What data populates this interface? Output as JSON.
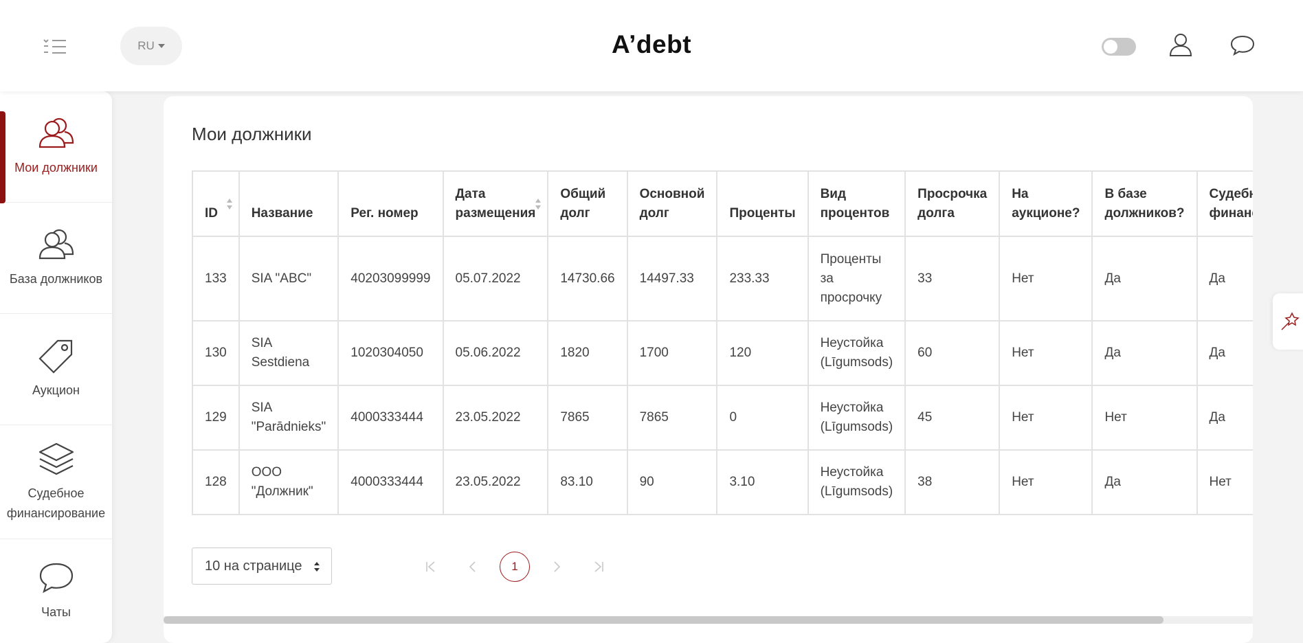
{
  "header": {
    "logo": "A’debt",
    "language": "RU",
    "icons": {
      "menu": "menu-list-icon",
      "profile": "user-icon",
      "chat": "chat-bubble-icon"
    }
  },
  "sidebar": {
    "items": [
      {
        "label": "Мои должники",
        "icon": "users-icon",
        "active": true
      },
      {
        "label": "База должников",
        "icon": "users-icon",
        "active": false
      },
      {
        "label": "Аукцион",
        "icon": "tag-icon",
        "active": false
      },
      {
        "label": "Судебное финансирование",
        "icon": "layers-icon",
        "active": false
      },
      {
        "label": "Чаты",
        "icon": "chat-bubble-icon",
        "active": false
      }
    ]
  },
  "main": {
    "title": "Мои должники",
    "table": {
      "columns": [
        "ID",
        "Название",
        "Рег. номер",
        "Дата размещения",
        "Общий долг",
        "Основной долг",
        "Проценты",
        "Вид процентов",
        "Просрочка долга",
        "На аукционе?",
        "В базе должников?",
        "Судебное финансирование"
      ],
      "rows": [
        [
          "133",
          "SIA \"ABC\"",
          "40203099999",
          "05.07.2022",
          "14730.66",
          "14497.33",
          "233.33",
          "Проценты за просрочку",
          "33",
          "Нет",
          "Да",
          "Да"
        ],
        [
          "130",
          "SIA Sestdiena",
          "1020304050",
          "05.06.2022",
          "1820",
          "1700",
          "120",
          "Неустойка (Līgumsods)",
          "60",
          "Нет",
          "Да",
          "Да"
        ],
        [
          "129",
          "SIA \"Parādnieks\"",
          "4000333444",
          "23.05.2022",
          "7865",
          "7865",
          "0",
          "Неустойка (Līgumsods)",
          "45",
          "Нет",
          "Нет",
          "Да"
        ],
        [
          "128",
          "ООО \"Должник\"",
          "4000333444",
          "23.05.2022",
          "83.10",
          "90",
          "3.10",
          "Неустойка (Līgumsods)",
          "38",
          "Нет",
          "Да",
          "Нет"
        ]
      ]
    },
    "pagination": {
      "per_page": "10 на странице",
      "current_page": "1"
    }
  },
  "colors": {
    "accent": "#9b1c1c",
    "background": "#f3f3f3"
  }
}
